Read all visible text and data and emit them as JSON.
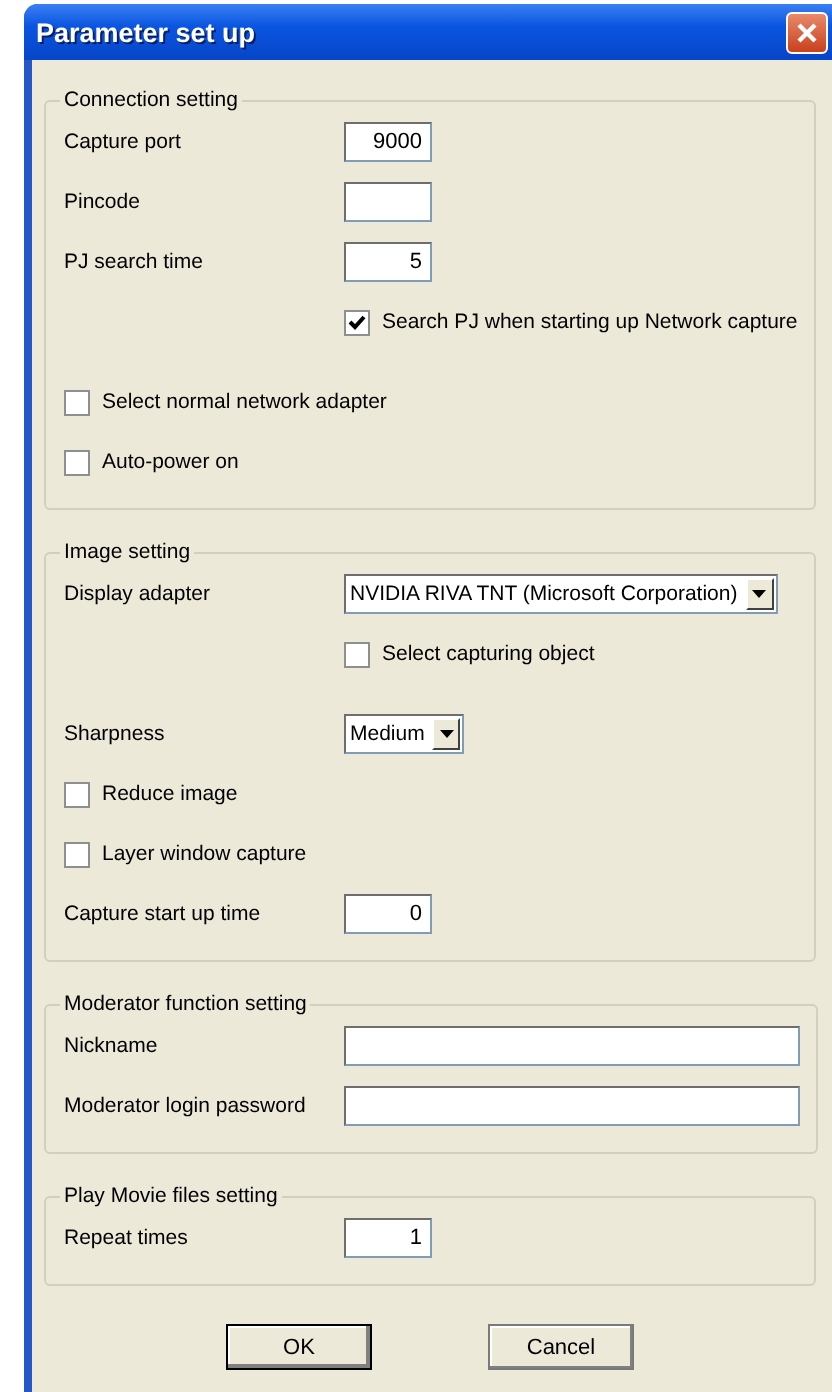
{
  "window": {
    "title": "Parameter set up"
  },
  "groups": [
    {
      "title": "Connection setting",
      "rows": [
        {
          "kind": "number_field",
          "label": "Capture port",
          "value": "9000"
        },
        {
          "kind": "number_field",
          "label": "Pincode"
        },
        {
          "kind": "number_field",
          "label": "PJ search time",
          "value": "5"
        },
        {
          "kind": "sub_checkbox",
          "label": "Search PJ when starting up Network capture",
          "checked": true
        },
        {
          "kind": "checkbox",
          "label": "Select normal network adapter",
          "checked": false
        },
        {
          "kind": "checkbox",
          "label": "Auto-power on",
          "checked": false
        }
      ]
    },
    {
      "title": "Image setting",
      "rows": [
        {
          "kind": "dropdown",
          "label": "Display adapter",
          "value": "NVIDIA RIVA TNT (Microsoft Corporation)"
        },
        {
          "kind": "sub_checkbox",
          "label": "Select capturing object",
          "checked": false
        },
        {
          "kind": "dropdown",
          "label": "Sharpness",
          "value": "Medium"
        },
        {
          "kind": "checkbox",
          "label": "Reduce image",
          "checked": false
        },
        {
          "kind": "checkbox",
          "label": "Layer window capture",
          "checked": false
        },
        {
          "kind": "number_field",
          "label": "Capture start up time",
          "value": "0"
        }
      ]
    },
    {
      "title": "Moderator function setting",
      "rows": [
        {
          "kind": "text_field",
          "label": "Nickname"
        },
        {
          "kind": "text_field",
          "label": "Moderator login password"
        }
      ]
    },
    {
      "title": "Play Movie files setting",
      "rows": [
        {
          "kind": "number_field",
          "label": "Repeat times",
          "value": "1"
        }
      ]
    }
  ],
  "buttons": [
    {
      "label": "OK",
      "default": true
    },
    {
      "label": "Cancel",
      "default": false
    }
  ]
}
